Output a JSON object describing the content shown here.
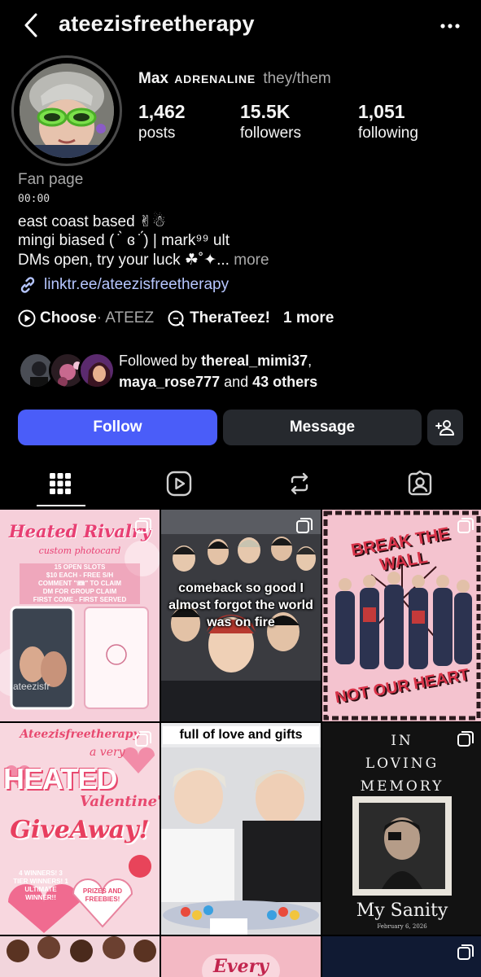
{
  "header": {
    "username": "ateezisfreetherapy"
  },
  "profile": {
    "name": "Max",
    "name_caps": "ADRENALINE",
    "pronouns": "they/them",
    "stats": [
      {
        "value": "1,462",
        "label": "posts"
      },
      {
        "value": "15.5K",
        "label": "followers"
      },
      {
        "value": "1,051",
        "label": "following"
      }
    ]
  },
  "bio": {
    "category": "Fan page",
    "time": "00:00",
    "line1": "east coast based ✌︎☃",
    "line2": "mingi biased ( ̇ ̀ ɞ ̇ ́) | mark⁹⁹ ult",
    "line3": "DMs open, try your luck ☘˚✦...",
    "more": " more",
    "link": "linktr.ee/ateezisfreetherapy"
  },
  "highlights": {
    "music_title": "Choose",
    "music_artist": " · ATEEZ",
    "channel": "TheraTeez!",
    "more": "1 more"
  },
  "followed_by": {
    "prefix": "Followed by ",
    "user1": "thereal_mimi37",
    "comma": ",",
    "user2": "maya_rose777",
    "and": " and ",
    "others": "43 others"
  },
  "buttons": {
    "follow": "Follow",
    "message": "Message"
  },
  "tabs": [
    "grid-icon",
    "reels-icon",
    "reposts-icon",
    "tagged-icon"
  ],
  "posts": {
    "p1_title": "Heated Rivalry",
    "p1_sub": "custom photocard",
    "p1_lines": [
      "15 OPEN SLOTS",
      "$10 EACH - FREE S/H",
      "COMMENT \"🎟\" TO CLAIM",
      "DM FOR GROUP CLAIM",
      "FIRST COME - FIRST SERVED"
    ],
    "p1_wm": "ateezisfr",
    "p2_caption": "comeback so good I almost forgot the world was on fire",
    "p3_top": "BREAK THE WALL",
    "p3_bottom": "NOT OUR HEART",
    "p4_top": "Ateezisfreetherapy",
    "p4_avery": "a very",
    "p4_heated": "HEATED",
    "p4_val": "Valentine's",
    "p4_give": "GiveAway!",
    "p4_winners": "4 WINNERS! 3 TIER WINNERS! 1 ULTIMATE WINNER!!",
    "p4_prizes": "PRIZES AND FREEBIES!",
    "p5_caption": "full of love and gifts",
    "p6_in": "IN",
    "p6_loving": "LOVING",
    "p6_memory": "MEMORY",
    "p6_sanity": "My Sanity",
    "p6_date": "February 6, 2026",
    "p8_text": "Every"
  },
  "colors": {
    "accent": "#4a5df9",
    "link": "#b6c6ff",
    "button_dark": "#26292e"
  }
}
